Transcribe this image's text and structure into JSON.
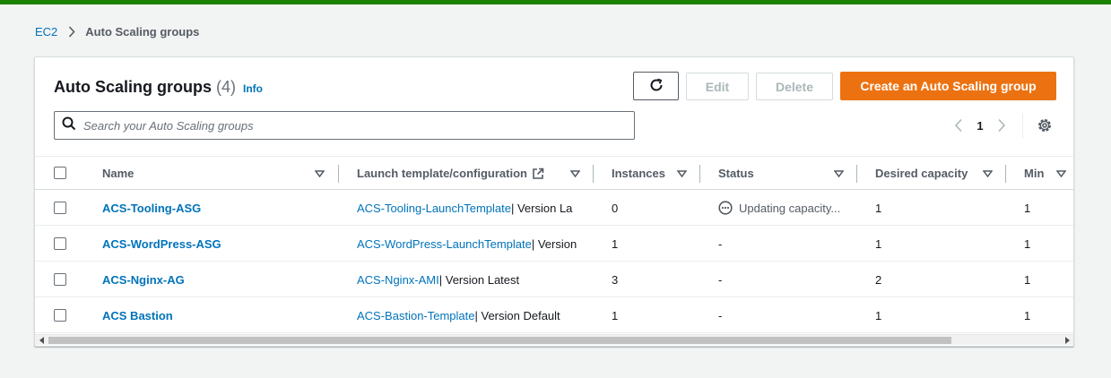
{
  "colors": {
    "topbar": "#1d8102",
    "link": "#0073bb",
    "primary": "#ec7211"
  },
  "breadcrumb": {
    "root": "EC2",
    "current": "Auto Scaling groups"
  },
  "panel": {
    "title": "Auto Scaling groups",
    "count": "(4)",
    "info": "Info"
  },
  "toolbar": {
    "refresh_icon": "refresh-icon",
    "edit_label": "Edit",
    "delete_label": "Delete",
    "create_label": "Create an Auto Scaling group"
  },
  "search": {
    "placeholder": "Search your Auto Scaling groups",
    "value": ""
  },
  "pagination": {
    "page": "1"
  },
  "table": {
    "columns": {
      "name": "Name",
      "launch": "Launch template/configuration",
      "instances": "Instances",
      "status": "Status",
      "desired": "Desired capacity",
      "min": "Min"
    },
    "rows": [
      {
        "name": "ACS-Tooling-ASG",
        "launch_link": "ACS-Tooling-LaunchTemplate",
        "launch_suffix": " | Version La",
        "instances": "0",
        "status": "Updating capacity...",
        "desired": "1",
        "min": "1"
      },
      {
        "name": "ACS-WordPress-ASG",
        "launch_link": "ACS-WordPress-LaunchTemplate",
        "launch_suffix": " | Version",
        "instances": "1",
        "status": "-",
        "desired": "1",
        "min": "1"
      },
      {
        "name": "ACS-Nginx-AG",
        "launch_link": "ACS-Nginx-AMI",
        "launch_suffix": " | Version Latest",
        "instances": "3",
        "status": "-",
        "desired": "2",
        "min": "1"
      },
      {
        "name": "ACS Bastion",
        "launch_link": "ACS-Bastion-Template",
        "launch_suffix": " | Version Default",
        "instances": "1",
        "status": "-",
        "desired": "1",
        "min": "1"
      }
    ]
  }
}
